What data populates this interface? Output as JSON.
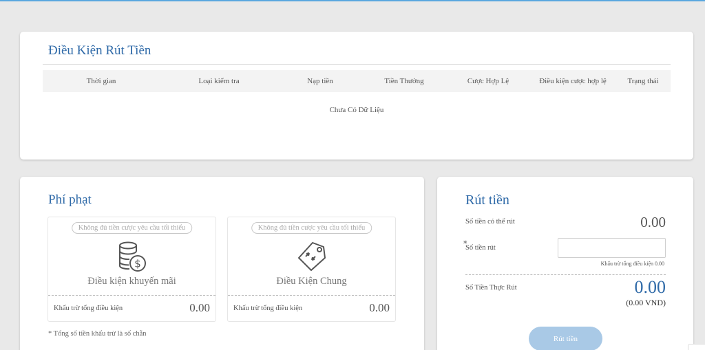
{
  "conditions": {
    "title": "Điều Kiện Rút Tiền",
    "columns": [
      "Thời gian",
      "Loại kiểm tra",
      "Nạp tiền",
      "Tiền Thưởng",
      "Cược Hợp Lệ",
      "Điều kiện cược hợp lệ",
      "Trạng thái"
    ],
    "empty_text": "Chưa Có Dữ Liệu"
  },
  "penalty": {
    "title": "Phí phạt",
    "boxes": [
      {
        "badge": "Không đủ tiền cược yêu cầu tối thiểu",
        "icon": "coins-dollar-icon",
        "label": "Điều kiện khuyến mãi",
        "footer_label": "Khấu trừ tổng điều kiện",
        "footer_value": "0.00"
      },
      {
        "badge": "Không đủ tiền cược yêu cầu tối thiểu",
        "icon": "price-tag-icon",
        "label": "Điều Kiện Chung",
        "footer_label": "Khấu trừ tổng điều kiện",
        "footer_value": "0.00"
      }
    ],
    "note": "* Tổng số tiền khấu trừ là số chẵn"
  },
  "withdraw": {
    "title": "Rút tiền",
    "available_label": "Số tiền có thể rút",
    "available_value": "0.00",
    "amount_label": "Số tiền rút",
    "amount_required_mark": "*",
    "amount_value": "",
    "deduct_hint": "Khấu trừ tổng điều kiện 0.00",
    "actual_label": "Số Tiền Thực Rút",
    "actual_value": "0.00",
    "actual_vnd": "(0.00 VND)",
    "submit_label": "Rút tiền"
  },
  "colors": {
    "accent": "#2f6aa8",
    "button": "#a9c9e6",
    "background": "#e9e9e9"
  }
}
